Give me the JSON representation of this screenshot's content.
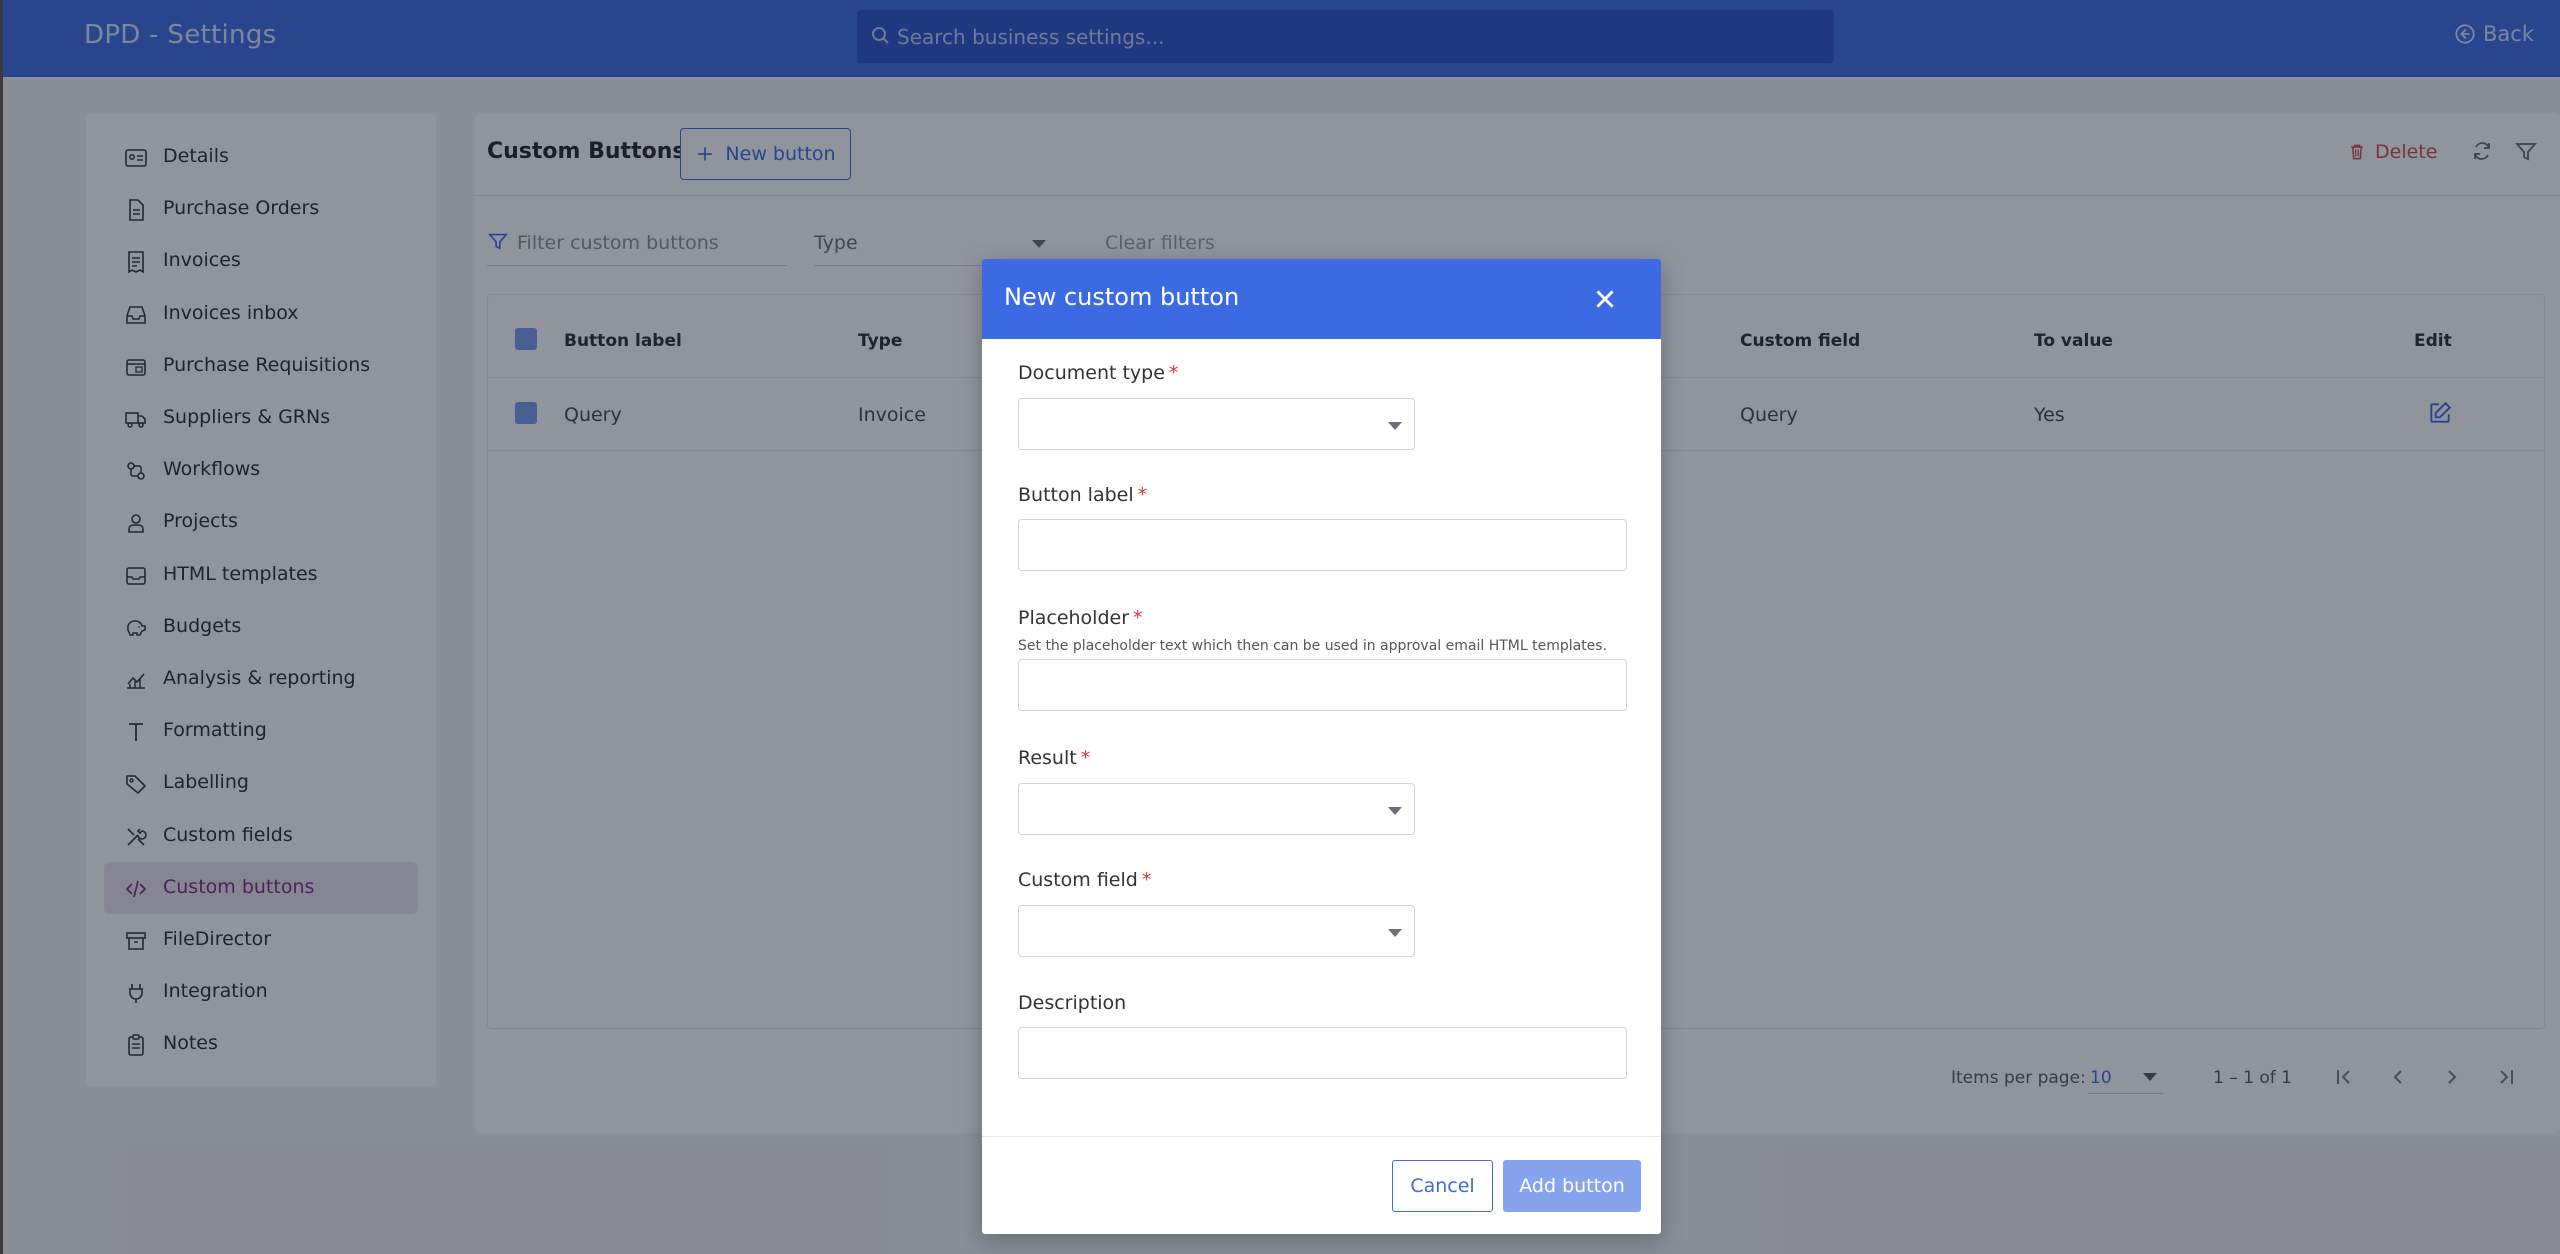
{
  "header": {
    "app_title": "DPD - Settings",
    "search_placeholder": "Search business settings...",
    "back_label": "Back"
  },
  "sidebar": {
    "items": [
      {
        "label": "Details",
        "icon": "id-card-icon"
      },
      {
        "label": "Purchase Orders",
        "icon": "document-icon"
      },
      {
        "label": "Invoices",
        "icon": "receipt-icon"
      },
      {
        "label": "Invoices inbox",
        "icon": "inbox-icon"
      },
      {
        "label": "Purchase Requisitions",
        "icon": "requisition-icon"
      },
      {
        "label": "Suppliers & GRNs",
        "icon": "truck-icon"
      },
      {
        "label": "Workflows",
        "icon": "workflow-icon"
      },
      {
        "label": "Projects",
        "icon": "user-badge-icon"
      },
      {
        "label": "HTML templates",
        "icon": "template-icon"
      },
      {
        "label": "Budgets",
        "icon": "piggy-bank-icon"
      },
      {
        "label": "Analysis & reporting",
        "icon": "chart-icon"
      },
      {
        "label": "Formatting",
        "icon": "text-format-icon"
      },
      {
        "label": "Labelling",
        "icon": "tag-icon"
      },
      {
        "label": "Custom fields",
        "icon": "tools-icon"
      },
      {
        "label": "Custom buttons",
        "icon": "code-icon"
      },
      {
        "label": "FileDirector",
        "icon": "archive-icon"
      },
      {
        "label": "Integration",
        "icon": "plug-icon"
      },
      {
        "label": "Notes",
        "icon": "notes-icon"
      }
    ],
    "active_index": 14
  },
  "main": {
    "title": "Custom Buttons",
    "new_button_label": "New button",
    "delete_label": "Delete",
    "filter_placeholder": "Filter custom buttons",
    "type_placeholder": "Type",
    "clear_filters_label": "Clear filters",
    "table": {
      "columns": [
        "Button label",
        "Type",
        "Custom field",
        "To value",
        "Edit"
      ],
      "rows": [
        {
          "button_label": "Query",
          "type": "Invoice",
          "custom_field": "Query",
          "to_value": "Yes"
        }
      ]
    },
    "pagination": {
      "items_per_page_label": "Items per page:",
      "items_per_page_value": "10",
      "range_label": "1 – 1 of 1"
    }
  },
  "modal": {
    "title": "New custom button",
    "fields": {
      "document_type": {
        "label": "Document type",
        "required_mark": "*"
      },
      "button_label": {
        "label": "Button label",
        "required_mark": "*"
      },
      "placeholder": {
        "label": "Placeholder",
        "required_mark": "*",
        "help": "Set the placeholder text which then can be used in approval email HTML templates."
      },
      "result": {
        "label": "Result",
        "required_mark": "*"
      },
      "custom_field": {
        "label": "Custom field",
        "required_mark": "*"
      },
      "description": {
        "label": "Description"
      }
    },
    "cancel_label": "Cancel",
    "submit_label": "Add button"
  },
  "colors": {
    "primary": "#3b6ae2",
    "active_nav_bg": "#ede3ef",
    "active_nav_text": "#7b2a86",
    "danger": "#d24a4a",
    "required": "#d23a3a"
  }
}
